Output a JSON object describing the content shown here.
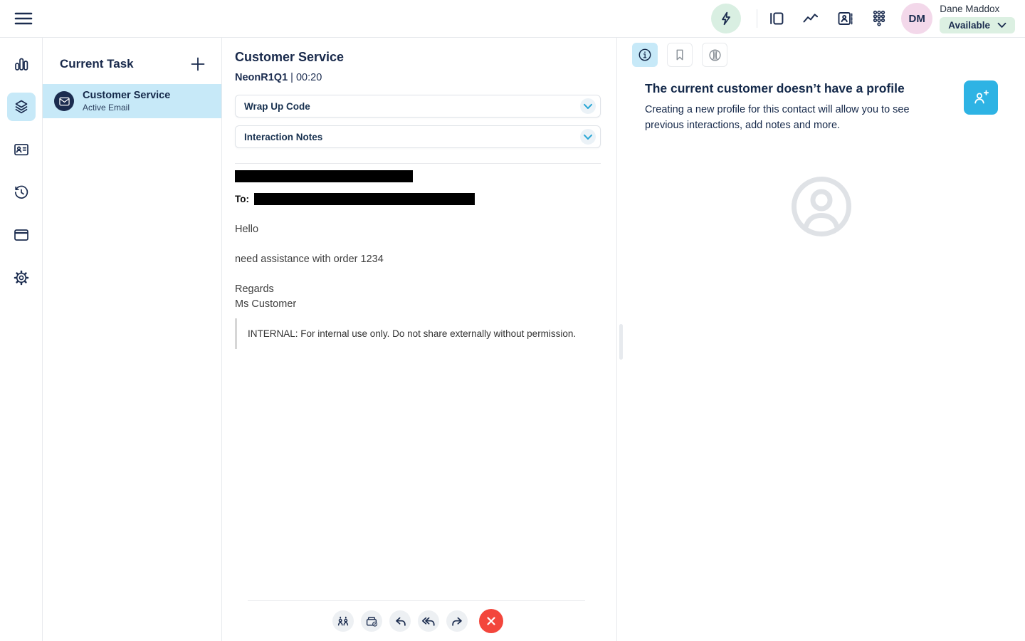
{
  "colors": {
    "navy": "#1B2C4F",
    "accent_cyan": "#2EB3E4",
    "active_blue": "#C7E9F8",
    "mint": "#D9EFE2",
    "status_green": "#DCF0E2",
    "avatar_pink": "#F3D8EA",
    "danger_red": "#F3463C"
  },
  "header": {
    "icons": [
      "hamburger-icon",
      "lightning-icon",
      "panels-icon",
      "performance-chart-icon",
      "directory-icon",
      "dialpad-icon"
    ],
    "user": {
      "initials": "DM",
      "name": "Dane Maddox",
      "status": {
        "label": "Available",
        "icon": "chevron-down-icon"
      }
    }
  },
  "nav_rail": {
    "items": [
      {
        "icon": "bar-chart-icon",
        "active": false
      },
      {
        "icon": "layers-icon",
        "active": true
      },
      {
        "icon": "contact-card-icon",
        "active": false
      },
      {
        "icon": "history-icon",
        "active": false
      },
      {
        "icon": "browser-window-icon",
        "active": false
      },
      {
        "icon": "gear-icon",
        "active": false
      }
    ]
  },
  "tasks": {
    "title": "Current Task",
    "add_icon": "plus-icon",
    "items": [
      {
        "icon": "email-icon",
        "title": "Customer Service",
        "subtitle": "Active Email",
        "selected": true
      }
    ]
  },
  "interaction": {
    "title": "Customer Service",
    "reference": "NeonR1Q1",
    "separator": "|",
    "timer": "00:20",
    "accordions": [
      {
        "label": "Wrap Up Code",
        "icon": "chevron-down-icon"
      },
      {
        "label": "Interaction Notes",
        "icon": "chevron-down-icon"
      }
    ],
    "email": {
      "from_redacted": true,
      "to_label": "To:",
      "to_redacted": true,
      "greeting": "Hello",
      "request": "need assistance with order 1234",
      "signoff": "Regards",
      "signature": "Ms Customer",
      "internal_note": "INTERNAL: For internal use only. Do not share externally without permission."
    },
    "toolbar": {
      "icons": [
        "transfer-icon",
        "park-icon",
        "reply-icon",
        "reply-all-icon",
        "forward-icon",
        "disconnect-icon"
      ]
    }
  },
  "profile": {
    "tabs": [
      {
        "icon": "info-icon",
        "active": true
      },
      {
        "icon": "bookmark-icon",
        "active": false
      },
      {
        "icon": "split-circle-icon",
        "active": false
      }
    ],
    "heading": "The current customer doesn’t have a profile",
    "description": "Creating a new profile for this contact will allow you to see previous interactions, add notes and more.",
    "add_button_icon": "person-add-icon",
    "placeholder_icon": "user-circle-icon"
  }
}
